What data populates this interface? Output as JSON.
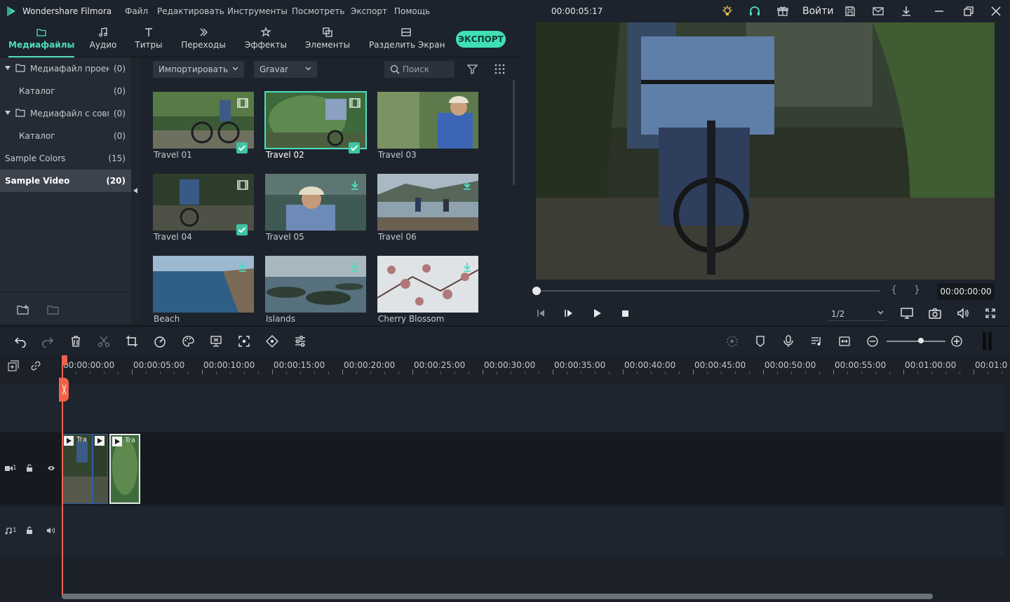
{
  "app": {
    "name": "Wondershare Filmora",
    "menu": [
      "Файл",
      "Редактировать",
      "Инструменты",
      "Посмотреть",
      "Экспорт",
      "Помощь"
    ],
    "timecode": "00:00:05:17",
    "login_label": "Войти",
    "accent_color": "#4fdcc0"
  },
  "tabs": [
    {
      "label": "Медиафайлы",
      "icon": "folder-icon",
      "active": true
    },
    {
      "label": "Аудио",
      "icon": "music-note-icon"
    },
    {
      "label": "Титры",
      "icon": "text-icon"
    },
    {
      "label": "Переходы",
      "icon": "transition-icon"
    },
    {
      "label": "Эффекты",
      "icon": "effects-icon"
    },
    {
      "label": "Элементы",
      "icon": "elements-icon"
    },
    {
      "label": "Разделить Экран",
      "icon": "split-screen-icon"
    }
  ],
  "export_label": "ЭКСПОРТ",
  "sidebar": {
    "items": [
      {
        "label": "Медиафайл проекта",
        "count": "(0)"
      },
      {
        "label": "Каталог",
        "count": "(0)"
      },
      {
        "label": "Медиафайл с совме",
        "count": "(0)"
      },
      {
        "label": "Каталог",
        "count": "(0)"
      },
      {
        "label": "Sample Colors",
        "count": "(15)"
      },
      {
        "label": "Sample Video",
        "count": "(20)"
      }
    ]
  },
  "library": {
    "import_label": "Импортировать",
    "source_label": "Gravar",
    "search_placeholder": "Поиск",
    "items": [
      {
        "label": "Travel 01",
        "state": "added"
      },
      {
        "label": "Travel 02",
        "state": "added"
      },
      {
        "label": "Travel 03",
        "state": "none"
      },
      {
        "label": "Travel 04",
        "state": "added"
      },
      {
        "label": "Travel 05",
        "state": "download"
      },
      {
        "label": "Travel 06",
        "state": "download"
      },
      {
        "label": "Beach",
        "state": "download"
      },
      {
        "label": "Islands",
        "state": "download"
      },
      {
        "label": "Cherry Blossom",
        "state": "download"
      }
    ]
  },
  "preview": {
    "time": "00:00:00:00",
    "brace_open": "{",
    "brace_close": "}",
    "quality": "1/2"
  },
  "timeline": {
    "ruler": [
      "00:00:00:00",
      "00:00:05:00",
      "00:00:10:00",
      "00:00:15:00",
      "00:00:20:00",
      "00:00:25:00",
      "00:00:30:00",
      "00:00:35:00",
      "00:00:40:00",
      "00:00:45:00",
      "00:00:50:00",
      "00:00:55:00",
      "00:01:00:00",
      "00:01:0"
    ],
    "video_track_label": "1",
    "audio_track_label": "1",
    "clips": [
      {
        "title": "Tra"
      },
      {
        "title": ""
      },
      {
        "title": "Tra"
      }
    ]
  }
}
